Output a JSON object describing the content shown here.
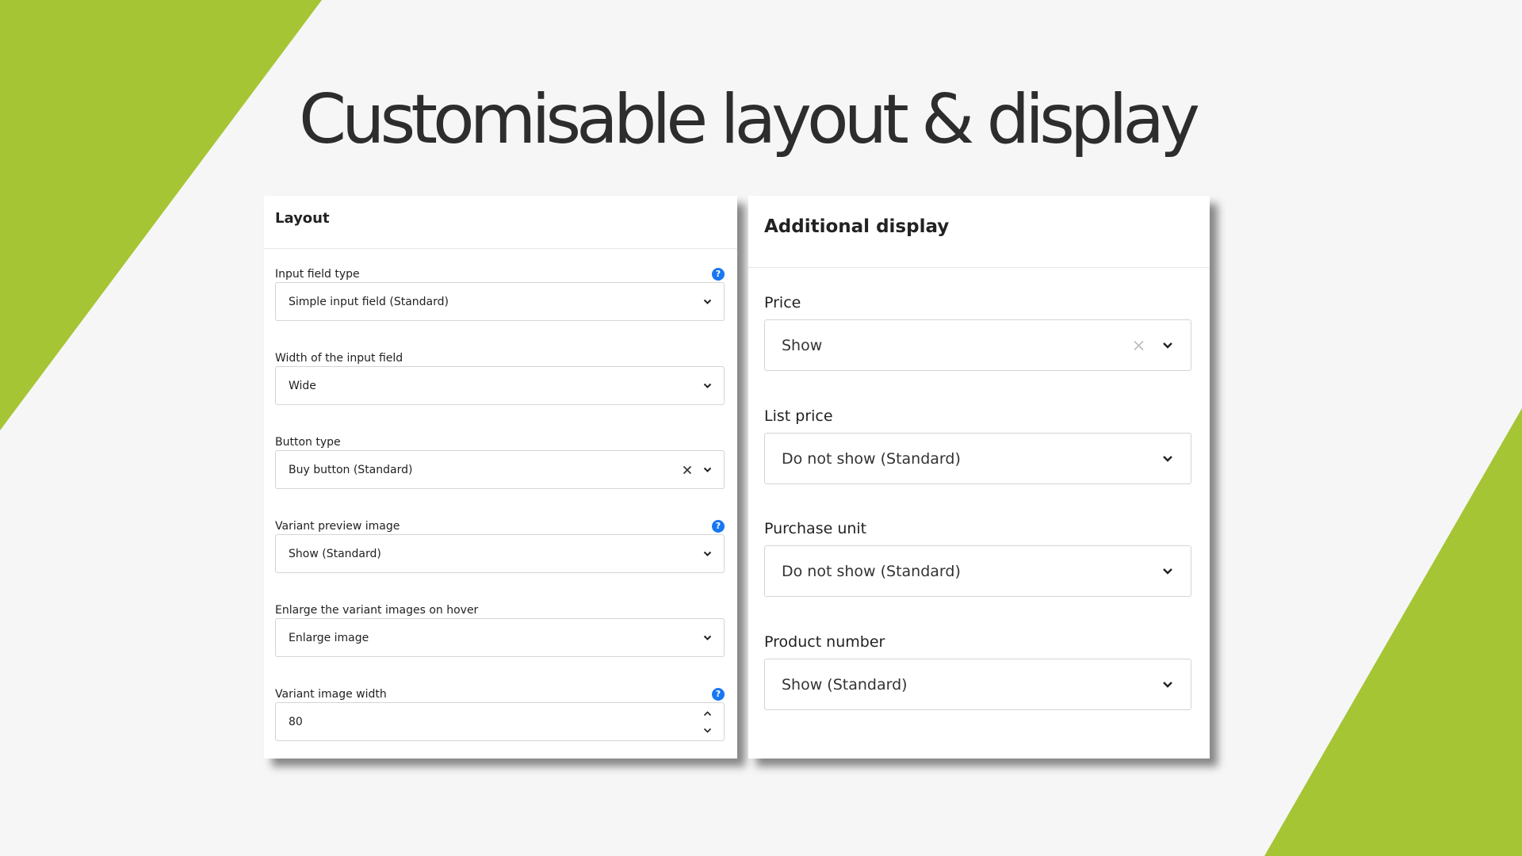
{
  "colors": {
    "accent_green": "#a5c534",
    "help_blue": "#1877f2",
    "background": "#f6f6f6"
  },
  "title": "Customisable layout & display",
  "layout_panel": {
    "title": "Layout",
    "fields": [
      {
        "label": "Input field type",
        "value": "Simple input field (Standard)",
        "help": true,
        "control": "select"
      },
      {
        "label": "Width of the input field",
        "value": "Wide",
        "control": "select"
      },
      {
        "label": "Button type",
        "value": "Buy button (Standard)",
        "control": "select-clearable"
      },
      {
        "label": "Variant preview image",
        "value": "Show (Standard)",
        "help": true,
        "control": "select"
      },
      {
        "label": "Enlarge the variant images on hover",
        "value": "Enlarge image",
        "control": "select"
      },
      {
        "label": "Variant image width",
        "value": "80",
        "help": true,
        "control": "number"
      }
    ],
    "help_glyph": "?"
  },
  "display_panel": {
    "title": "Additional display",
    "fields": [
      {
        "label": "Price",
        "value": "Show",
        "control": "select-clearable"
      },
      {
        "label": "List price",
        "value": "Do not show (Standard)",
        "control": "select"
      },
      {
        "label": "Purchase unit",
        "value": "Do not show (Standard)",
        "control": "select"
      },
      {
        "label": "Product number",
        "value": "Show (Standard)",
        "control": "select"
      }
    ]
  }
}
